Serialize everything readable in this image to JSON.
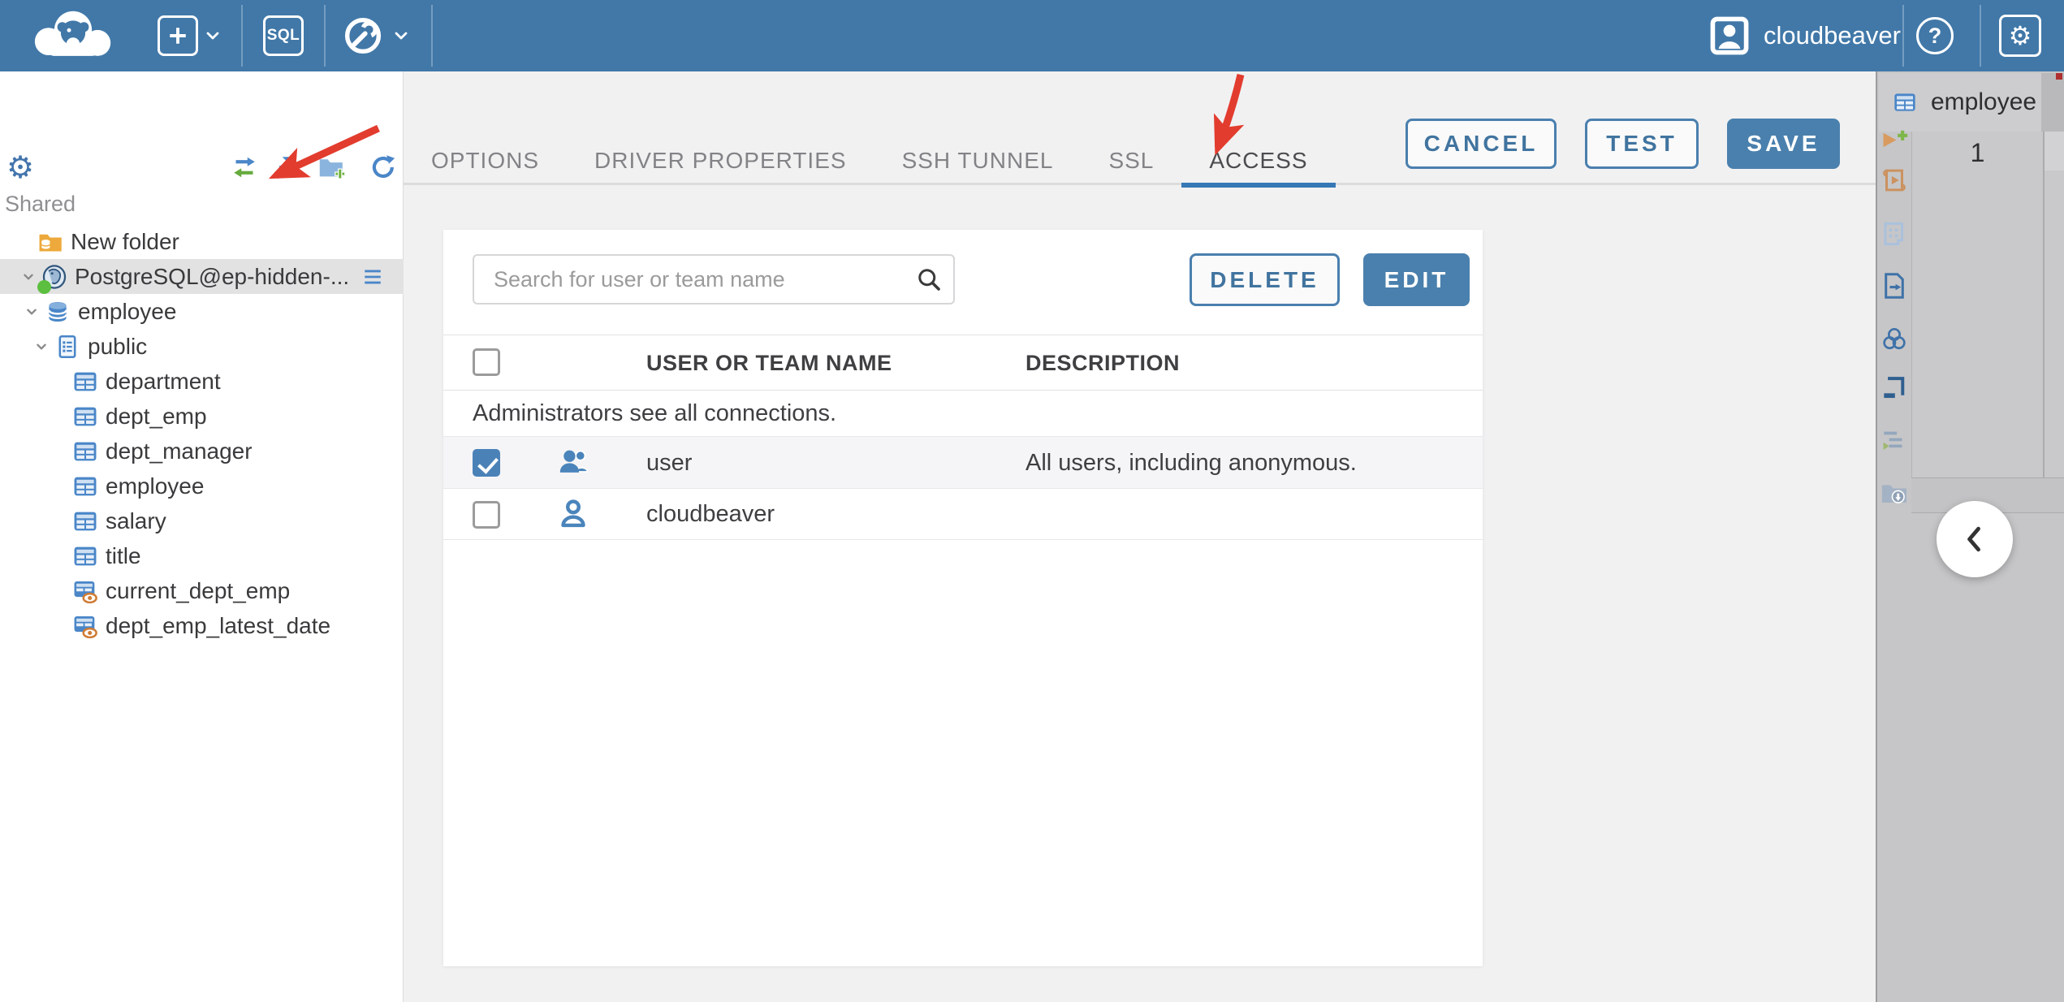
{
  "topbar": {
    "sql_label": "SQL",
    "user_label": "cloudbeaver",
    "help_glyph": "?",
    "settings_glyph": "⚙"
  },
  "sidebar": {
    "section_label": "Shared",
    "tree": [
      {
        "label": "New folder",
        "type": "folder"
      },
      {
        "label": "PostgreSQL@ep-hidden-...",
        "type": "postgres-connection",
        "selected": true,
        "expanded": true,
        "status": "connected"
      },
      {
        "label": "employee",
        "type": "database",
        "expanded": true
      },
      {
        "label": "public",
        "type": "schema",
        "expanded": true
      },
      {
        "label": "department",
        "type": "table"
      },
      {
        "label": "dept_emp",
        "type": "table"
      },
      {
        "label": "dept_manager",
        "type": "table"
      },
      {
        "label": "employee",
        "type": "table"
      },
      {
        "label": "salary",
        "type": "table"
      },
      {
        "label": "title",
        "type": "table"
      },
      {
        "label": "current_dept_emp",
        "type": "view"
      },
      {
        "label": "dept_emp_latest_date",
        "type": "view"
      }
    ]
  },
  "main": {
    "tabs": [
      {
        "label": "OPTIONS",
        "active": false
      },
      {
        "label": "DRIVER PROPERTIES",
        "active": false
      },
      {
        "label": "SSH TUNNEL",
        "active": false
      },
      {
        "label": "SSL",
        "active": false
      },
      {
        "label": "ACCESS",
        "active": true
      }
    ],
    "actions": {
      "cancel_label": "CANCEL",
      "test_label": "TEST",
      "save_label": "SAVE"
    },
    "access": {
      "search_placeholder": "Search for user or team name",
      "delete_label": "DELETE",
      "edit_label": "EDIT",
      "columns": [
        "USER OR TEAM NAME",
        "DESCRIPTION"
      ],
      "notice": "Administrators see all connections.",
      "rows": [
        {
          "name": "user",
          "description": "All users, including anonymous.",
          "checked": true,
          "icon": "team-icon"
        },
        {
          "name": "cloudbeaver",
          "description": "",
          "checked": false,
          "icon": "user-icon"
        }
      ]
    }
  },
  "right_panel": {
    "tab_label": "employee",
    "row_number": "1"
  },
  "icons": [
    "cloudbeaver-logo",
    "new-connection-icon",
    "sql-editor-icon",
    "connection-wizard-icon",
    "user-avatar-icon",
    "help-icon",
    "settings-gear-icon",
    "sync-icon",
    "collapse-all-icon",
    "add-folder-icon",
    "refresh-icon",
    "search-icon",
    "team-icon",
    "user-icon",
    "table-icon",
    "view-icon",
    "database-icon",
    "schema-icon",
    "folder-icon",
    "postgres-icon"
  ],
  "colors": {
    "topbar": "#4178a8",
    "accent": "#4a80ad",
    "tab_underline": "#3677b5",
    "checkbox_checked": "#4a82b8",
    "selected_row": "#e2e2e3",
    "annotation_arrow": "#e23c2e",
    "right_panel_bg": "#c6c6c8"
  }
}
